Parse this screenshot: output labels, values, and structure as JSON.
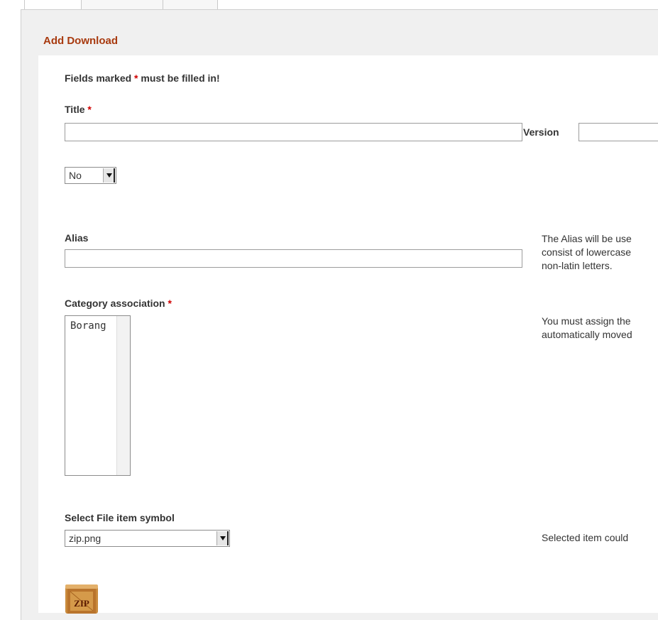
{
  "legend": "Add Download",
  "required_note": {
    "prefix": "Fields marked",
    "star": "*",
    "suffix": "must be filled in!"
  },
  "title_field": {
    "label": "Title",
    "star": "*",
    "value": ""
  },
  "version_field": {
    "label": "Version",
    "value": ""
  },
  "yesno_select": {
    "selected": "No"
  },
  "alias_field": {
    "label": "Alias",
    "value": "",
    "help_lines": [
      "The Alias will be use",
      "consist of lowercase",
      "non-latin letters."
    ]
  },
  "category_field": {
    "label": "Category association",
    "star": "*",
    "options": [
      "Borang"
    ],
    "help_lines": [
      "You must assign the",
      "automatically moved"
    ]
  },
  "file_symbol_field": {
    "label": "Select File item symbol",
    "selected": "zip.png",
    "help": "Selected item could"
  },
  "zip_preview": {
    "icon": "zip-file-icon",
    "text": "ZIP"
  },
  "colors": {
    "legend": "#a83a0f",
    "required": "#d00000",
    "panel_bg": "#f0f0f0"
  }
}
